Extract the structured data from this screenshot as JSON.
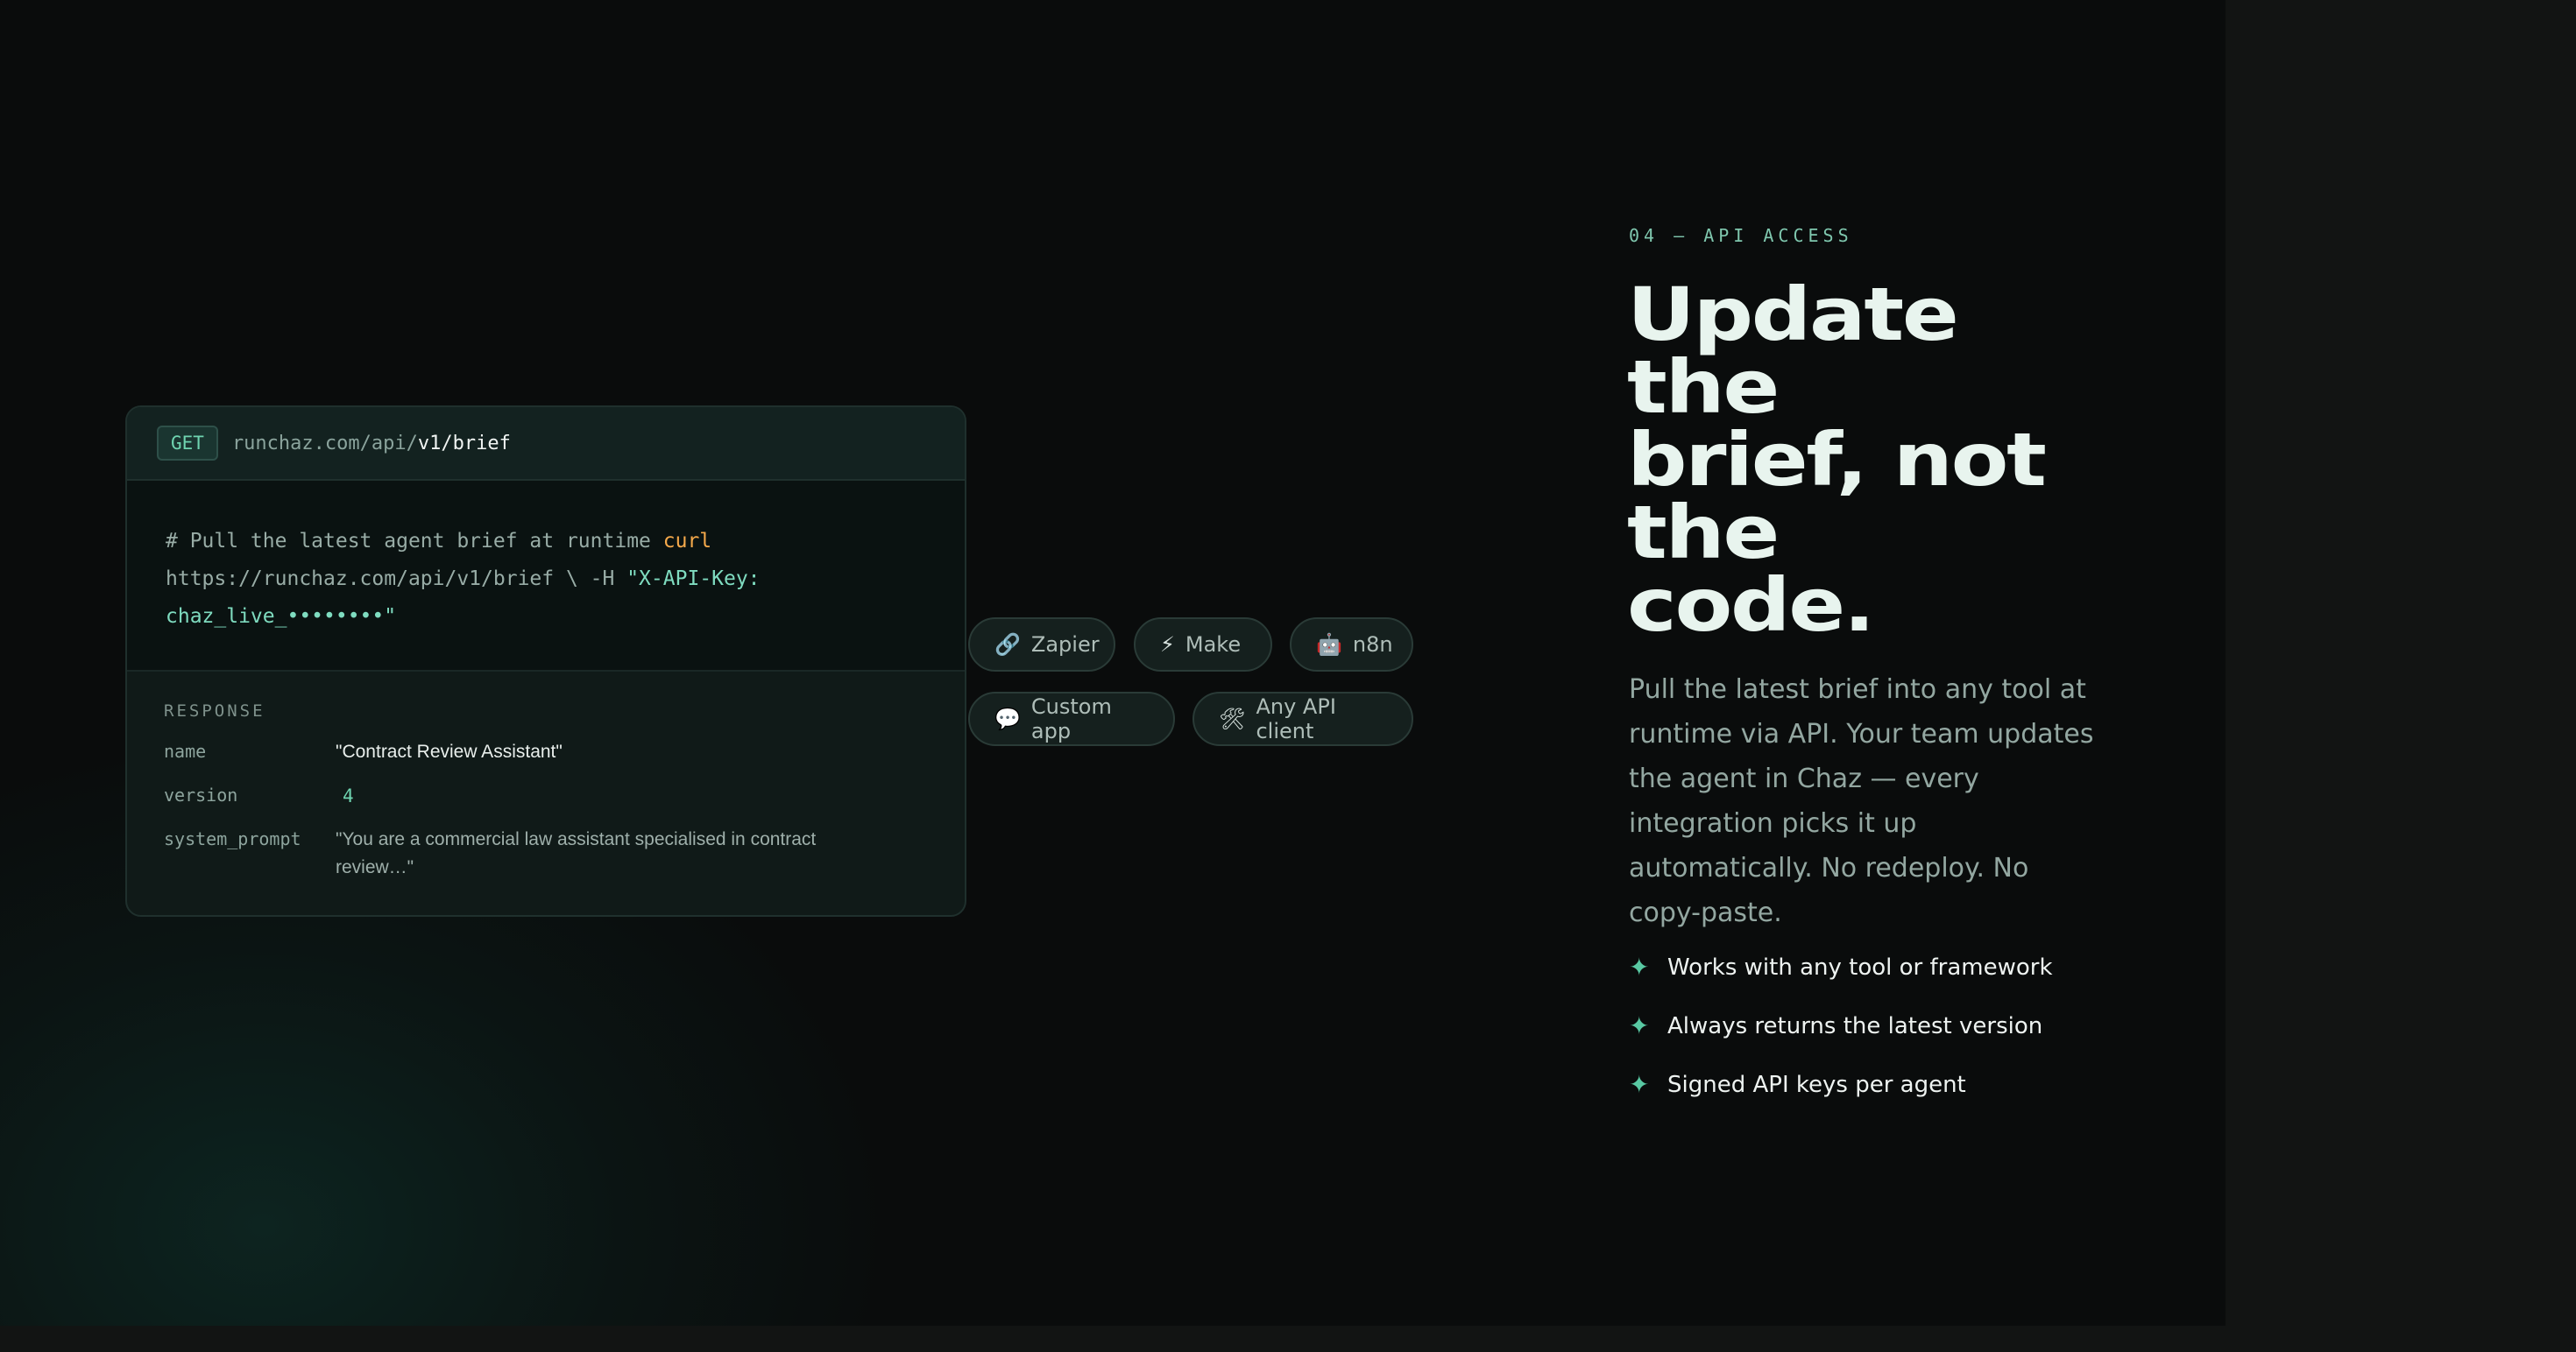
{
  "code_card": {
    "method": "GET",
    "url_base": "runchaz.com/api/",
    "url_path": "v1/brief",
    "code": {
      "comment": "# Pull the latest agent brief at runtime",
      "command": "curl",
      "line2": "https://runchaz.com/api/v1/brief \\ -H ",
      "header_open": "\"X-API-Key:",
      "header_value": "chaz_live_••••••••\""
    },
    "response": {
      "label": "RESPONSE",
      "rows": [
        {
          "key": "name",
          "value": "\"Contract Review Assistant\""
        },
        {
          "key": "version",
          "value": "4"
        },
        {
          "key": "system_prompt",
          "value": "\"You are a commercial law assistant specialised in contract review…\""
        }
      ]
    }
  },
  "integrations": [
    {
      "label": "Zapier",
      "icon": "link-icon",
      "glyph": "🔗"
    },
    {
      "label": "Make",
      "icon": "lightning-icon",
      "glyph": "⚡"
    },
    {
      "label": "n8n",
      "icon": "robot-icon",
      "glyph": "🤖"
    },
    {
      "label": "Custom app",
      "icon": "speech-bubble-icon",
      "glyph": "💬"
    },
    {
      "label": "Any API client",
      "icon": "tools-icon",
      "glyph": "🛠"
    }
  ],
  "section": {
    "eyebrow": "04 — API ACCESS",
    "headline_lines": [
      "Update",
      "the",
      "brief, not",
      "the",
      "code."
    ],
    "lede": "Pull the latest brief into any tool at runtime via API. Your team updates the agent in Chaz — every integration picks it up automatically. No redeploy. No copy-paste.",
    "features": [
      "Works with any tool or framework",
      "Always returns the latest version",
      "Signed API keys per agent"
    ]
  },
  "colors": {
    "accent": "#6fd4b0",
    "background": "#0a0c0c",
    "headline": "#e8f4ee",
    "command": "#f5a94b"
  }
}
